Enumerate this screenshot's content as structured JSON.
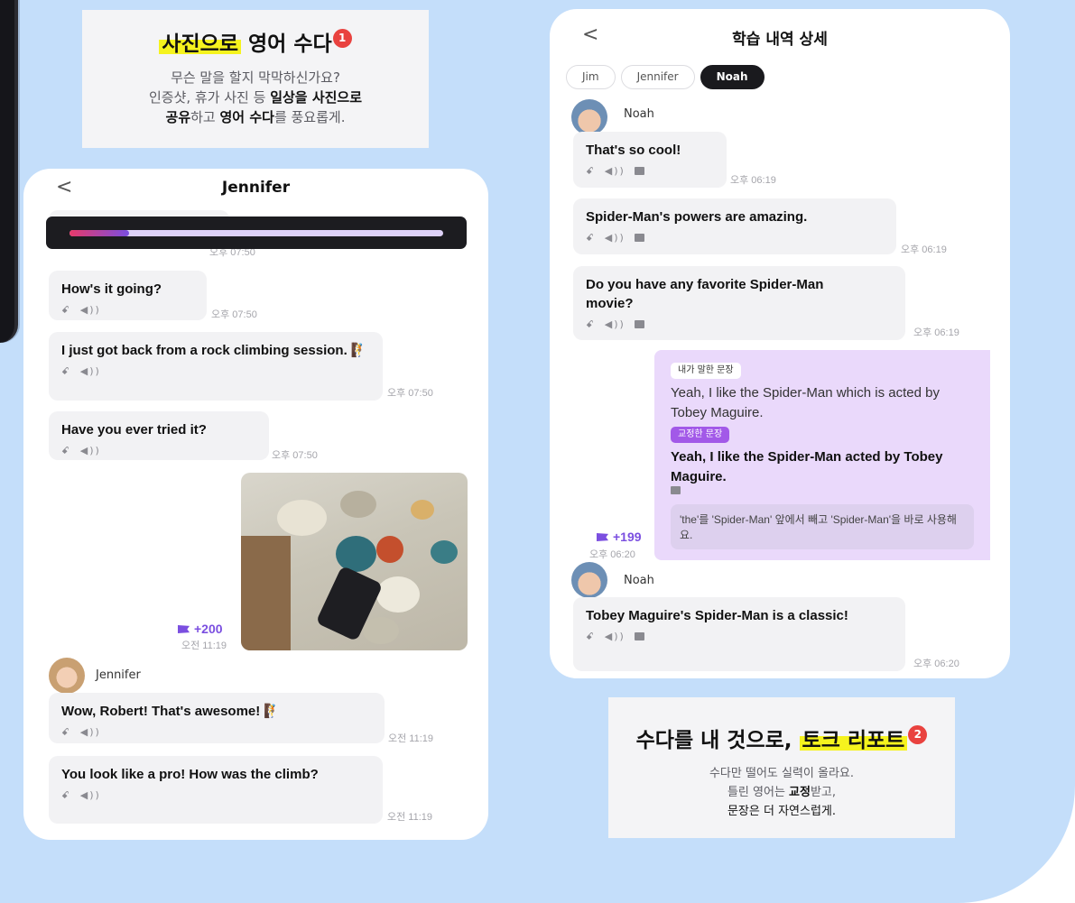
{
  "promo_top": {
    "title_highlight": "사진으로",
    "title_rest": " 영어 수다",
    "badge": "1",
    "line1": "무슨 말을 할지 막막하신가요?",
    "line2_a": "인증샷, 휴가 사진 등 ",
    "line2_b": "일상을 사진으로",
    "line3_a": "공유",
    "line3_b": "하고 ",
    "line3_c": "영어 수다",
    "line3_d": "를 풍요롭게."
  },
  "promo_bottom": {
    "title_rest": "수다를 내 것으로, ",
    "title_highlight": "토크 리포트",
    "badge": "2",
    "line1": "수다만 떨어도 실력이 올라요.",
    "line2_a": "틀린 영어는 ",
    "line2_b": "교정",
    "line2_c": "받고,",
    "line3": "문장은 더 자연스럽게."
  },
  "left_phone": {
    "back": "<",
    "title": "Jennifer",
    "progress": 0.16,
    "hidden_time": "오후 07:50",
    "messages": [
      {
        "text": "How's it going?",
        "time": "오후 07:50"
      },
      {
        "text": "I just got back from a rock climbing session. 🧗",
        "time": "오후 07:50"
      },
      {
        "text": "Have you ever tried it?",
        "time": "오후 07:50"
      }
    ],
    "photo_points": "+200",
    "photo_time": "오전 11:19",
    "speaker": "Jennifer",
    "replies": [
      {
        "text": "Wow, Robert! That's awesome! 🧗",
        "time": "오전 11:19"
      },
      {
        "text": "You look like a pro! How was the climb?",
        "time": "오전 11:19"
      }
    ]
  },
  "right_phone": {
    "back": "<",
    "title": "학습 내역 상세",
    "chips": [
      "Jim",
      "Jennifer",
      "Noah"
    ],
    "speaker": "Noah",
    "messages": [
      {
        "text": "That's so cool!",
        "time": "오후 06:19"
      },
      {
        "text": "Spider-Man's powers are amazing.",
        "time": "오후 06:19"
      },
      {
        "text": "Do you have any favorite Spider-Man movie?",
        "time": "오후 06:19"
      }
    ],
    "correction": {
      "said_label": "내가 말한 문장",
      "said": "Yeah, I like the Spider-Man which is acted by Tobey Maguire.",
      "corrected_label": "교정한 문장",
      "corrected": "Yeah, I like the Spider-Man acted by Tobey Maguire.",
      "explanation": "'the'를 'Spider-Man' 앞에서 빼고 'Spider-Man'을 바로 사용해요.",
      "points": "+199",
      "time": "오후 06:20"
    },
    "speaker2": "Noah",
    "last_message": {
      "text": "Tobey Maguire's Spider-Man is a classic!",
      "time": "오후 06:20"
    }
  },
  "colors": {
    "background": "#c4defa",
    "highlight": "#f5f31e",
    "accent_purple": "#7b4fe0",
    "correction_bg": "#ead9fb",
    "badge_red": "#e9423f"
  },
  "icons": [
    "translate-icon",
    "speaker-icon",
    "memo-icon",
    "flag-icon",
    "back-chevron-icon"
  ]
}
